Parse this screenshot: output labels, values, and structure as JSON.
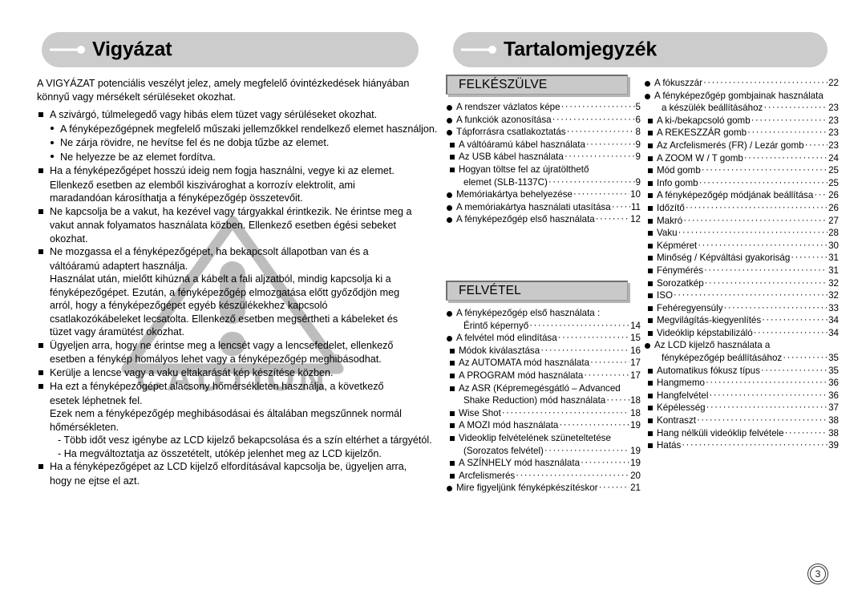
{
  "left_page": {
    "title": "Vigyázat",
    "intro": "A VIGYÁZAT potenciális veszélyt jelez, amely megfelelő óvintézkedések hiányában könnyű vagy mérsékelt sérüléseket okozhat.",
    "items": [
      {
        "type": "square",
        "text": "A szivárgó, túlmelegedő vagy hibás elem tüzet vagy sérüléseket okozhat."
      },
      {
        "type": "dot",
        "text": "A fényképezőgépnek megfelelő műszaki jellemzőkkel rendelkező elemet használjon."
      },
      {
        "type": "dot",
        "text": "Ne zárja rövidre, ne hevítse fel és ne dobja tűzbe az elemet."
      },
      {
        "type": "dot",
        "text": "Ne helyezze be az elemet fordítva."
      },
      {
        "type": "square",
        "text": "Ha a fényképezőgépet hosszú ideig nem fogja használni, vegye ki az elemet."
      },
      {
        "type": "cont",
        "text": "Ellenkező esetben az elemből kiszivároghat a korrozív elektrolit, ami"
      },
      {
        "type": "cont",
        "text": "maradandóan károsíthatja a fényképezőgép összetevőit."
      },
      {
        "type": "square",
        "text": "Ne kapcsolja be a vakut, ha kezével vagy tárgyakkal érintkezik. Ne érintse meg a"
      },
      {
        "type": "cont",
        "text": "vakut annak folyamatos használata közben. Ellenkező esetben égési sebeket"
      },
      {
        "type": "cont",
        "text": "okozhat."
      },
      {
        "type": "square",
        "text": "Ne mozgassa el a fényképezőgépet, ha bekapcsolt állapotban van és a"
      },
      {
        "type": "cont",
        "text": "váltóáramú adaptert használja."
      },
      {
        "type": "cont",
        "text": "Használat után, mielőtt kihúzná a kábelt a fali aljzatból, mindig kapcsolja ki a"
      },
      {
        "type": "cont",
        "text": "fényképezőgépet. Ezután, a fényképezőgép elmozgatása előtt győződjön meg"
      },
      {
        "type": "cont",
        "text": "arról, hogy a fényképezőgépet egyéb készülékekhez kapcsoló"
      },
      {
        "type": "cont",
        "text": "csatlakozókábeleket lecsatolta. Ellenkező esetben megsértheti a kábeleket és"
      },
      {
        "type": "cont",
        "text": "tüzet vagy áramütést okozhat."
      },
      {
        "type": "square",
        "text": "Ügyeljen arra, hogy ne érintse meg a lencsét vagy a lencsefedelet, ellenkező"
      },
      {
        "type": "cont",
        "text": "esetben a fénykép homályos lehet vagy a fényképezőgép meghibásodhat."
      },
      {
        "type": "square",
        "text": "Kerülje a lencse vagy a vaku eltakarását kép készítése közben."
      },
      {
        "type": "square",
        "text": "Ha ezt a fényképezőgépet alacsony hőmérsékleten használja, a következő"
      },
      {
        "type": "cont",
        "text": "esetek léphetnek fel."
      },
      {
        "type": "cont",
        "text": "Ezek nem a fényképezőgép meghibásodásai és általában megszűnnek normál"
      },
      {
        "type": "cont",
        "text": "hőmérsékleten."
      },
      {
        "type": "dash",
        "text": "- Több időt vesz igénybe az LCD kijelző bekapcsolása és a szín eltérhet a tárgyétól."
      },
      {
        "type": "dash",
        "text": "- Ha megváltoztatja az összetételt, utókép jelenhet meg az LCD kijelzőn."
      },
      {
        "type": "square",
        "text": "Ha a fényképezőgépet az LCD kijelző elfordításával kapcsolja be, ügyeljen arra,"
      },
      {
        "type": "cont",
        "text": "hogy ne ejtse el azt."
      }
    ],
    "watermark_text": "CAUTION",
    "watermark_color": "#bdbdbd"
  },
  "right_page": {
    "title": "Tartalomjegyzék",
    "sections": [
      {
        "label": "FELKÉSZÜLVE",
        "entries": [
          {
            "level": 1,
            "label": "A rendszer vázlatos képe",
            "page": "5"
          },
          {
            "level": 1,
            "label": "A funkciók azonosítása",
            "page": "6"
          },
          {
            "level": 1,
            "label": "Tápforrásra csatlakoztatás",
            "page": "8"
          },
          {
            "level": 2,
            "label": "A váltóáramú kábel használata",
            "page": "9"
          },
          {
            "level": 2,
            "label": "Az USB kábel használata",
            "page": "9"
          },
          {
            "level": 2,
            "label": "Hogyan töltse fel az újratölthető",
            "page": ""
          },
          {
            "level": 0,
            "label": "elemet (SLB-1137C)",
            "page": "9"
          },
          {
            "level": 1,
            "label": "Memóriakártya behelyezése",
            "page": "10"
          },
          {
            "level": 1,
            "label": "A memóriakártya használati utasítása",
            "page": "11"
          },
          {
            "level": 1,
            "label": "A fényképezőgép első használata",
            "page": "12"
          }
        ]
      },
      {
        "label": "FELVÉTEL",
        "entries": [
          {
            "level": 1,
            "label": "A fényképezőgép első használata :",
            "page": ""
          },
          {
            "level": 0,
            "label": "Érintő képernyő",
            "page": "14"
          },
          {
            "level": 1,
            "label": "A felvétel mód elindítása",
            "page": "15"
          },
          {
            "level": 2,
            "label": "Módok kiválasztása",
            "page": "16"
          },
          {
            "level": 2,
            "label": "Az AUTOMATA mód használata",
            "page": "17"
          },
          {
            "level": 2,
            "label": "A PROGRAM mód használata",
            "page": "17"
          },
          {
            "level": 2,
            "label": "Az ASR (Képremegésgátló – Advanced",
            "page": ""
          },
          {
            "level": 0,
            "label": "Shake Reduction) mód használata",
            "page": "18"
          },
          {
            "level": 2,
            "label": "Wise Shot",
            "page": "18"
          },
          {
            "level": 2,
            "label": "A MOZI mód használata",
            "page": "19"
          },
          {
            "level": 2,
            "label": "Videoklip felvételének szüneteltetése",
            "page": ""
          },
          {
            "level": 0,
            "label": "(Sorozatos felvétel)",
            "page": "19"
          },
          {
            "level": 2,
            "label": "A SZÍNHELY mód használata",
            "page": "19"
          },
          {
            "level": 2,
            "label": "Arcfelismerés",
            "page": "20"
          },
          {
            "level": 1,
            "label": "Mire figyeljünk fényképkészítéskor",
            "page": "21"
          }
        ]
      }
    ],
    "right_column_entries": [
      {
        "level": 1,
        "label": "A fókuszzár",
        "page": "22"
      },
      {
        "level": 1,
        "label": "A fényképezőgép gombjainak használata",
        "page": ""
      },
      {
        "level": 0,
        "label": "a készülék beállításához",
        "page": "23"
      },
      {
        "level": 2,
        "label": "A ki-/bekapcsoló gomb",
        "page": "23"
      },
      {
        "level": 2,
        "label": "A REKESZZÁR gomb",
        "page": "23"
      },
      {
        "level": 2,
        "label": "Az Arcfelismerés (FR) / Lezár gomb",
        "page": "23"
      },
      {
        "level": 2,
        "label": "A ZOOM W / T gomb",
        "page": "24"
      },
      {
        "level": 2,
        "label": "Mód gomb",
        "page": "25"
      },
      {
        "level": 2,
        "label": "Info gomb",
        "page": "25"
      },
      {
        "level": 2,
        "label": "A fényképezőgép módjának beállítása",
        "page": "26"
      },
      {
        "level": 2,
        "label": "Időzítő",
        "page": "26"
      },
      {
        "level": 2,
        "label": "Makró",
        "page": "27"
      },
      {
        "level": 2,
        "label": "Vaku",
        "page": "28"
      },
      {
        "level": 2,
        "label": "Képméret",
        "page": "30"
      },
      {
        "level": 2,
        "label": "Minőség / Képváltási gyakoriság",
        "page": "31"
      },
      {
        "level": 2,
        "label": "Fénymérés",
        "page": "31"
      },
      {
        "level": 2,
        "label": "Sorozatkép",
        "page": "32"
      },
      {
        "level": 2,
        "label": "ISO",
        "page": "32"
      },
      {
        "level": 2,
        "label": "Fehéregyensúly",
        "page": "33"
      },
      {
        "level": 2,
        "label": "Megvilágítás-kiegyenlítés",
        "page": "34"
      },
      {
        "level": 2,
        "label": "Videóklip képstabilizáló",
        "page": "34"
      },
      {
        "level": 1,
        "label": "Az LCD kijelző használata a",
        "page": ""
      },
      {
        "level": 0,
        "label": "fényképezőgép beállításához",
        "page": "35"
      },
      {
        "level": 2,
        "label": "Automatikus fókusz típus",
        "page": "35"
      },
      {
        "level": 2,
        "label": "Hangmemo",
        "page": "36"
      },
      {
        "level": 2,
        "label": "Hangfelvétel",
        "page": "36"
      },
      {
        "level": 2,
        "label": "Képélesség",
        "page": "37"
      },
      {
        "level": 2,
        "label": "Kontraszt",
        "page": "38"
      },
      {
        "level": 2,
        "label": "Hang nélküli videóklip felvétele",
        "page": "38"
      },
      {
        "level": 2,
        "label": "Hatás",
        "page": "39"
      }
    ]
  },
  "page_number": "3",
  "colors": {
    "title_bar": "#cccccc",
    "section_bar": "#c9c9c9",
    "watermark": "#bdbdbd"
  }
}
